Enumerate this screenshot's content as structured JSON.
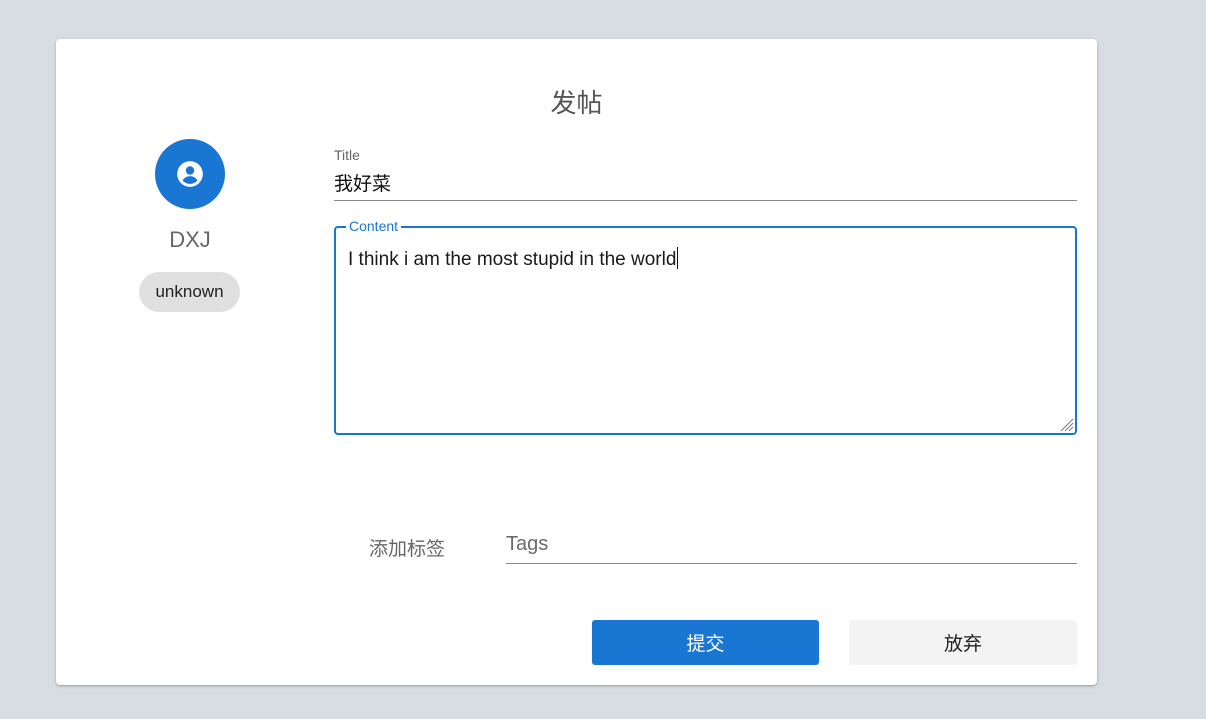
{
  "header": {
    "title": "发帖"
  },
  "user": {
    "avatar_icon": "account-circle-icon",
    "name": "DXJ",
    "role": "unknown"
  },
  "form": {
    "title_label": "Title",
    "title_value": "我好菜",
    "content_label": "Content",
    "content_value": "I think i am the most stupid in the world",
    "tags_label": "添加标签",
    "tags_placeholder": "Tags",
    "tags_value": ""
  },
  "actions": {
    "submit_label": "提交",
    "discard_label": "放弃"
  },
  "colors": {
    "primary": "#1976d2",
    "background": "#d8dde4",
    "card": "#ffffff",
    "chip": "#e0e0e0",
    "secondary_button": "#f3f3f3"
  }
}
